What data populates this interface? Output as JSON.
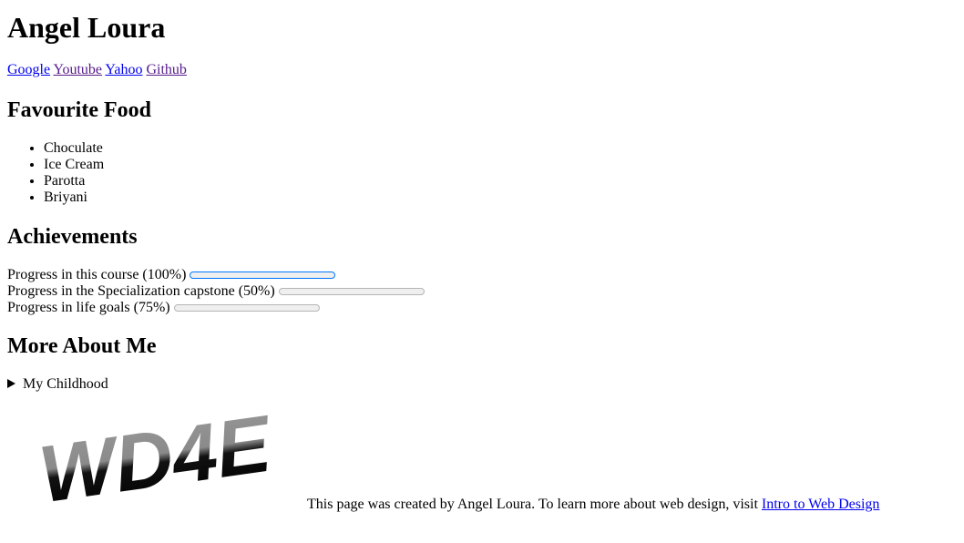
{
  "title": "Angel Loura",
  "nav": [
    {
      "label": "Google",
      "visited": false
    },
    {
      "label": "Youtube",
      "visited": true
    },
    {
      "label": "Yahoo",
      "visited": false
    },
    {
      "label": "Github",
      "visited": true
    }
  ],
  "food": {
    "heading": "Favourite Food",
    "items": [
      "Choculate",
      "Ice Cream",
      "Parotta",
      "Briyani"
    ]
  },
  "achievements": {
    "heading": "Achievements",
    "items": [
      {
        "label": "Progress in this course (100%)",
        "percent": 100
      },
      {
        "label": "Progress in the Specialization capstone (50%)",
        "percent": 50
      },
      {
        "label": "Progress in life goals (75%)",
        "percent": 75
      }
    ]
  },
  "more": {
    "heading": "More About Me",
    "summary": "My Childhood"
  },
  "logo": {
    "text": "WD4E"
  },
  "footer": {
    "text": "This page was created by Angel Loura. To learn more about web design, visit ",
    "link": "Intro to Web Design"
  },
  "colors": {
    "link": "#0000ee",
    "visited_link": "#551a8b",
    "progress_fill": "#0075ff",
    "progress_track": "#efefef"
  }
}
